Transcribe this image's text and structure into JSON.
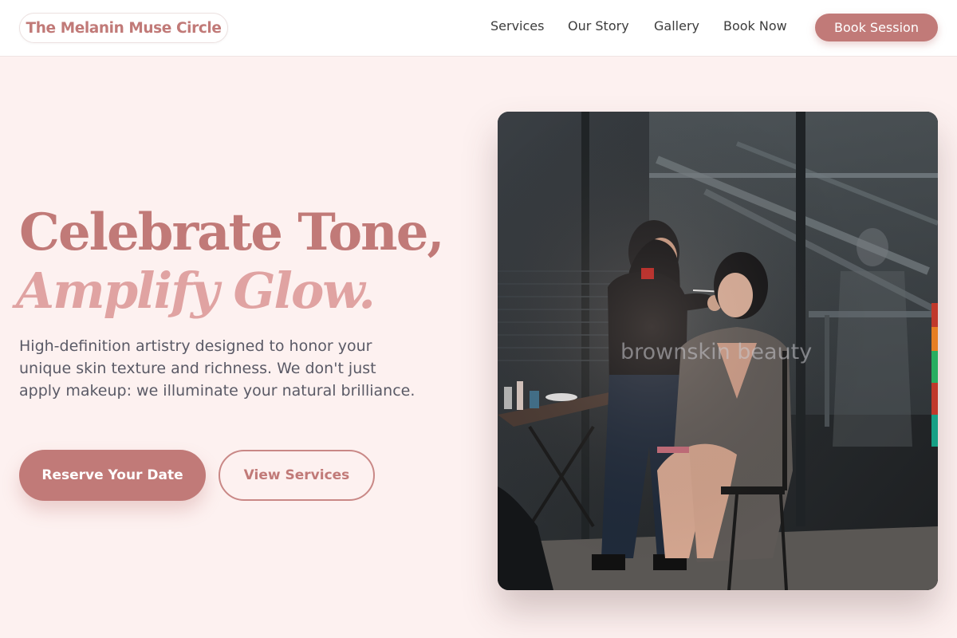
{
  "header": {
    "logo": "The Melanin Muse Circle",
    "nav": [
      "Services",
      "Our Story",
      "Gallery",
      "Book Now"
    ],
    "cta": "Book Session"
  },
  "hero": {
    "headline_line1": "Celebrate Tone,",
    "headline_line2": "Amplify Glow.",
    "description": "High-definition artistry designed to honor your unique skin texture and richness. We don't just apply makeup: we illuminate your natural brilliance.",
    "primary_button": "Reserve Your Date",
    "secondary_button": "View Services",
    "image_watermark": "brownskin beauty"
  },
  "colors": {
    "accent": "#c17a78",
    "accent_light": "#e0a3a2",
    "background": "#fdf1f0"
  }
}
